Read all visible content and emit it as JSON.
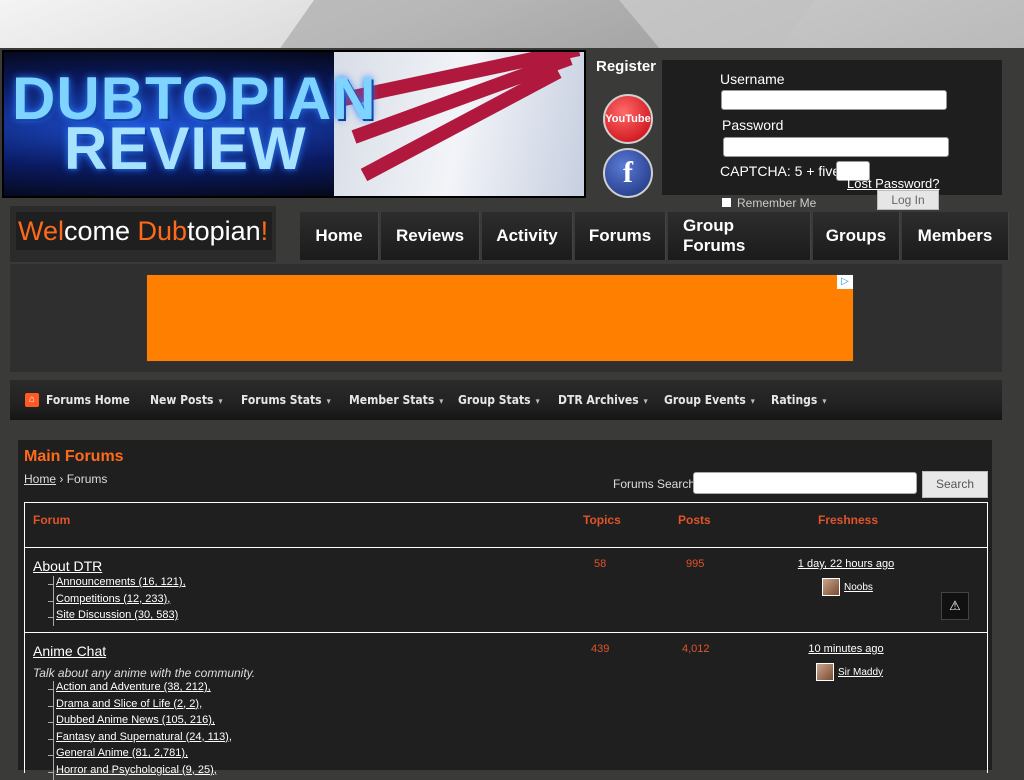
{
  "header": {
    "banner_line1": "DUBTOPIAN",
    "banner_line2": "REVIEW",
    "register": "Register",
    "youtube_label": "YouTube",
    "facebook_label": "f"
  },
  "login": {
    "username_label": "Username",
    "password_label": "Password",
    "captcha_label": "CAPTCHA: 5 + five =",
    "lost_password": "Lost Password?",
    "remember_me": "Remember Me",
    "login_button": "Log In"
  },
  "welcome": {
    "part1": "Wel",
    "part2": "come ",
    "part3": "Dub",
    "part4": "topian",
    "part5": "!"
  },
  "nav": [
    "Home",
    "Reviews",
    "Activity",
    "Forums",
    "Group Forums",
    "Groups",
    "Members"
  ],
  "colors": {
    "accent": "#ff6a1a",
    "ad": "#ff7f00",
    "header_text": "#e0542a"
  },
  "forum_toolbar": {
    "home": "Forums Home",
    "items": [
      "New Posts",
      "Forums Stats",
      "Member Stats",
      "Group Stats",
      "DTR Archives",
      "Group Events",
      "Ratings"
    ]
  },
  "main": {
    "title": "Main Forums",
    "breadcrumb_home": "Home",
    "breadcrumb_sep": "›",
    "breadcrumb_current": "Forums",
    "search_label": "Forums Search :",
    "search_button": "Search",
    "columns": {
      "forum": "Forum",
      "topics": "Topics",
      "posts": "Posts",
      "freshness": "Freshness"
    },
    "forums": [
      {
        "name": "About DTR",
        "description": "",
        "subforums": [
          "Announcements (16, 121),",
          "Competitions (12, 233),",
          "Site Discussion (30, 583)"
        ],
        "topics": "58",
        "posts": "995",
        "freshness": "1 day, 22 hours ago",
        "last_user": "Noobs"
      },
      {
        "name": "Anime Chat",
        "description": "Talk about any anime with the community.",
        "subforums": [
          "Action and Adventure (38, 212),",
          "Drama and Slice of Life (2, 2),",
          "Dubbed Anime News (105, 216),",
          "Fantasy and Supernatural (24, 113),",
          "General Anime (81, 2,781),",
          "Horror and Psychological (9, 25),"
        ],
        "topics": "439",
        "posts": "4,012",
        "freshness": "10 minutes ago",
        "last_user": "Sir Maddy"
      }
    ]
  }
}
